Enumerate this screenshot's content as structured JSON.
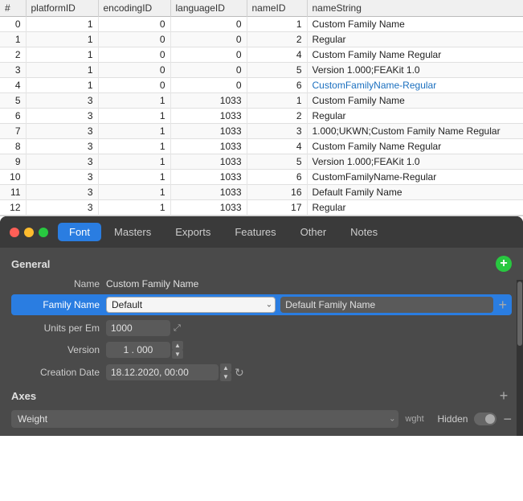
{
  "table": {
    "columns": [
      "#",
      "platformID",
      "encodingID",
      "languageID",
      "nameID",
      "nameString"
    ],
    "rows": [
      {
        "index": "0",
        "platformID": "1",
        "encodingID": "0",
        "languageID": "0",
        "nameID": "1",
        "nameString": "Custom Family Name",
        "blue": false
      },
      {
        "index": "1",
        "platformID": "1",
        "encodingID": "0",
        "languageID": "0",
        "nameID": "2",
        "nameString": "Regular",
        "blue": false
      },
      {
        "index": "2",
        "platformID": "1",
        "encodingID": "0",
        "languageID": "0",
        "nameID": "4",
        "nameString": "Custom Family Name Regular",
        "blue": false
      },
      {
        "index": "3",
        "platformID": "1",
        "encodingID": "0",
        "languageID": "0",
        "nameID": "5",
        "nameString": "Version 1.000;FEAKit 1.0",
        "blue": false
      },
      {
        "index": "4",
        "platformID": "1",
        "encodingID": "0",
        "languageID": "0",
        "nameID": "6",
        "nameString": "CustomFamilyName-Regular",
        "blue": true
      },
      {
        "index": "5",
        "platformID": "3",
        "encodingID": "1",
        "languageID": "1033",
        "nameID": "1",
        "nameString": "Custom Family Name",
        "blue": false
      },
      {
        "index": "6",
        "platformID": "3",
        "encodingID": "1",
        "languageID": "1033",
        "nameID": "2",
        "nameString": "Regular",
        "blue": false
      },
      {
        "index": "7",
        "platformID": "3",
        "encodingID": "1",
        "languageID": "1033",
        "nameID": "3",
        "nameString": "1.000;UKWN;Custom Family Name Regular",
        "blue": false
      },
      {
        "index": "8",
        "platformID": "3",
        "encodingID": "1",
        "languageID": "1033",
        "nameID": "4",
        "nameString": "Custom Family Name Regular",
        "blue": false
      },
      {
        "index": "9",
        "platformID": "3",
        "encodingID": "1",
        "languageID": "1033",
        "nameID": "5",
        "nameString": "Version 1.000;FEAKit 1.0",
        "blue": false
      },
      {
        "index": "10",
        "platformID": "3",
        "encodingID": "1",
        "languageID": "1033",
        "nameID": "6",
        "nameString": "CustomFamilyName-Regular",
        "blue": false
      },
      {
        "index": "11",
        "platformID": "3",
        "encodingID": "1",
        "languageID": "1033",
        "nameID": "16",
        "nameString": "Default Family Name",
        "blue": false
      },
      {
        "index": "12",
        "platformID": "3",
        "encodingID": "1",
        "languageID": "1033",
        "nameID": "17",
        "nameString": "Regular",
        "blue": false
      }
    ]
  },
  "panel": {
    "tabs": [
      "Font",
      "Masters",
      "Exports",
      "Features",
      "Other",
      "Notes"
    ],
    "active_tab": "Font",
    "general": {
      "title": "General",
      "name_label": "Name",
      "name_value": "Custom Family Name",
      "family_name_label": "Family Name",
      "family_select_options": [
        "Default"
      ],
      "family_select_value": "Default",
      "family_value": "Default Family Name",
      "units_label": "Units per Em",
      "units_value": "1000",
      "version_label": "Version",
      "version_value": "1 . 000",
      "creation_label": "Creation Date",
      "creation_value": "18.12.2020, 00:00"
    },
    "axes": {
      "title": "Axes",
      "weight_select_options": [
        "Weight"
      ],
      "weight_select_value": "Weight",
      "weight_tag": "wght",
      "hidden_label": "Hidden"
    }
  }
}
